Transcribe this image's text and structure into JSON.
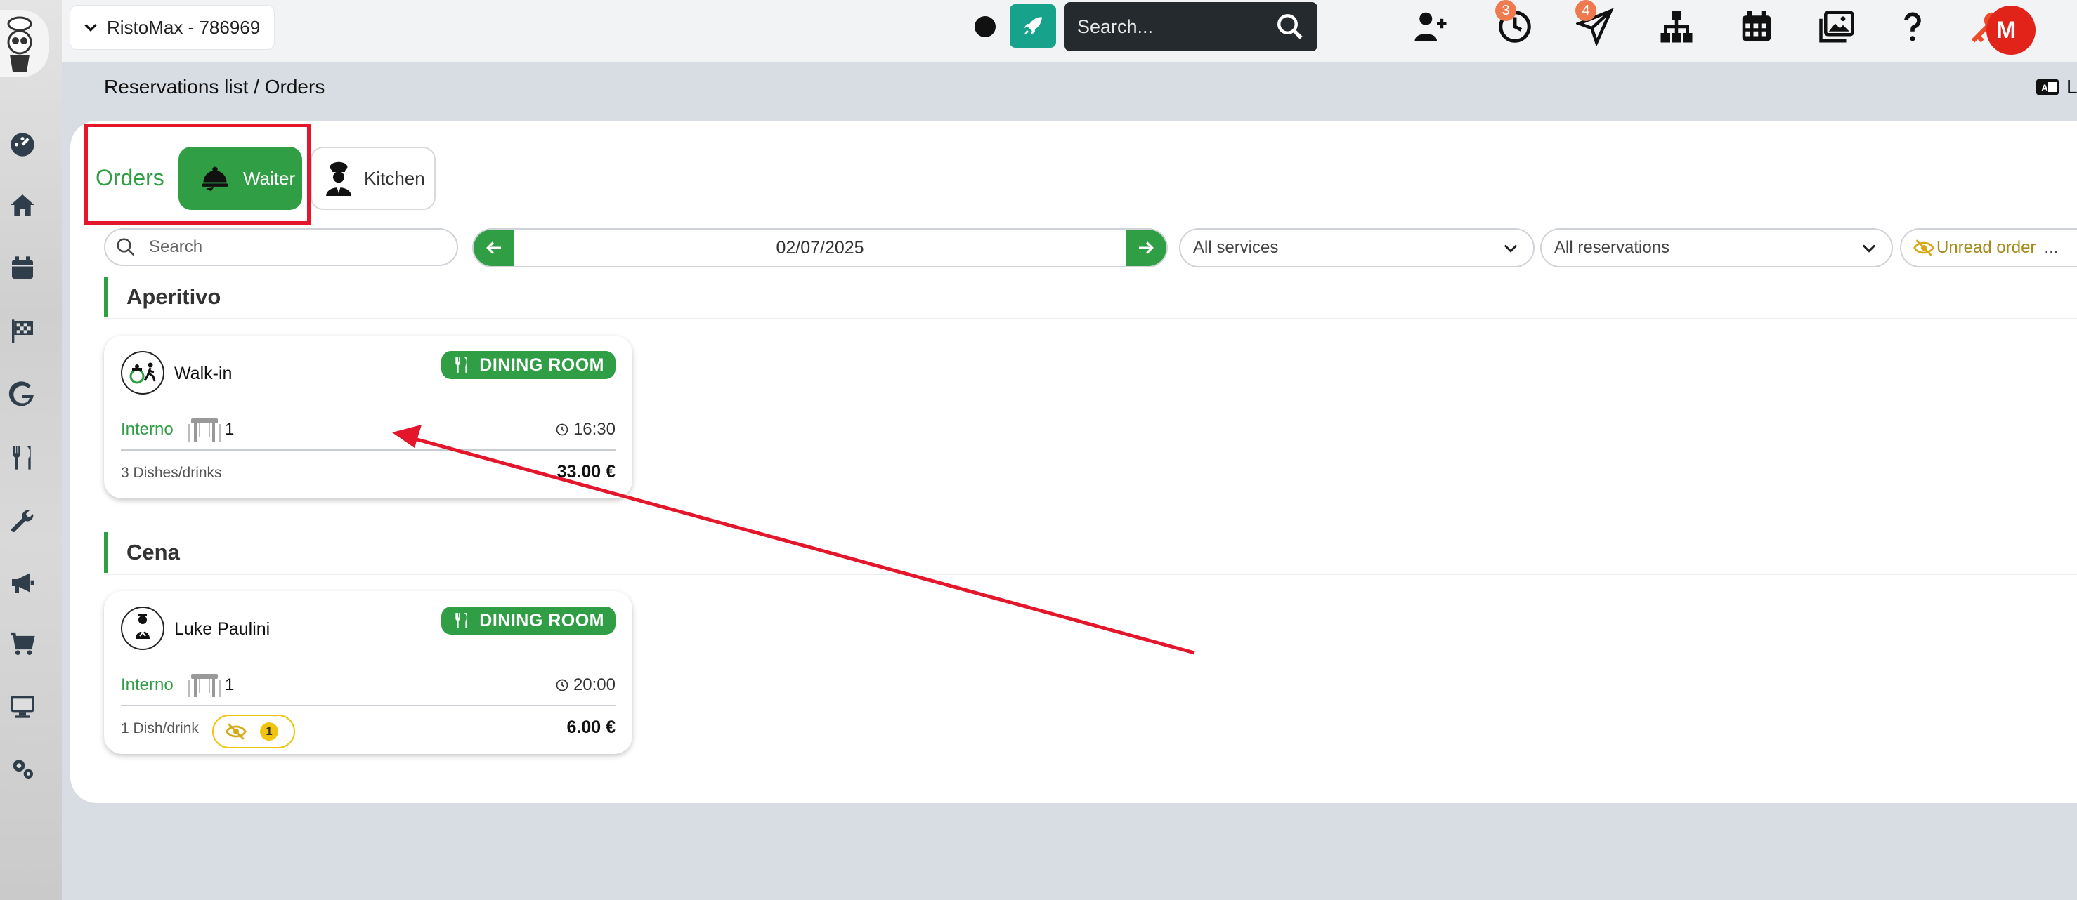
{
  "topbar": {
    "account_name": "RistoMax - 786969",
    "search_placeholder": "Search...",
    "notifications": {
      "reservations_badge": "3",
      "messages_badge": "4"
    },
    "avatar_initials": "M"
  },
  "breadcrumb": "Reservations list / Orders",
  "language_label": "L",
  "orders": {
    "title": "Orders",
    "modes": {
      "waiter": "Waiter",
      "kitchen": "Kitchen"
    },
    "selected_mode": "Waiter"
  },
  "filters": {
    "search_placeholder": "Search",
    "date": "02/07/2025",
    "services": "All services",
    "reservations": "All reservations",
    "unread": "Unread order",
    "unread_ellipsis": "..."
  },
  "sections": [
    {
      "title": "Aperitivo",
      "orders": [
        {
          "guest": "Walk-in",
          "room": "DINING ROOM",
          "zone": "Interno",
          "table": "1",
          "time": "16:30",
          "items": "3 Dishes/drinks",
          "total": "33.00 €"
        }
      ]
    },
    {
      "title": "Cena",
      "orders": [
        {
          "guest": "Luke Paulini",
          "room": "DINING ROOM",
          "zone": "Interno",
          "table": "1",
          "time": "20:00",
          "items": "1 Dish/drink",
          "unread_count": "1",
          "total": "6.00 €"
        }
      ]
    }
  ],
  "colors": {
    "accent_green": "#2f9e44",
    "teal": "#17a28c",
    "annotation_red": "#e3162b",
    "warning_yellow": "#f1c40f",
    "avatar_red": "#e2231a"
  },
  "icons": {
    "sidebar": [
      "dashboard-icon",
      "home-icon",
      "calendar-icon",
      "checkered-flag-icon",
      "google-icon",
      "fork-knife-icon",
      "wrench-icon",
      "megaphone-icon",
      "cart-icon",
      "monitor-icon",
      "gears-icon"
    ],
    "topbar": [
      "rocket-icon",
      "search-icon",
      "add-user-icon",
      "clock-icon",
      "send-icon",
      "sitemap-icon",
      "calendar-grid-icon",
      "gallery-icon",
      "help-icon",
      "key-icon"
    ]
  }
}
